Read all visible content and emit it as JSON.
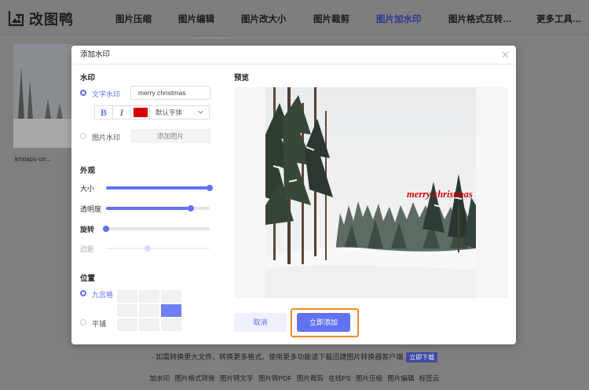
{
  "app": {
    "brand": "改图鸭"
  },
  "nav": {
    "items": [
      {
        "label": "图片压缩"
      },
      {
        "label": "图片编辑"
      },
      {
        "label": "图片改大小"
      },
      {
        "label": "图片裁剪"
      },
      {
        "label": "图片加水印",
        "active": true
      },
      {
        "label": "图片格式互转…"
      },
      {
        "label": "更多工具…"
      }
    ],
    "accent": "#2d3a92"
  },
  "background": {
    "thumb_label": "kristaps-un...",
    "notice": "· 如需转换更大文件、转换更多格式、使用更多功能请下载迅捷图片转换器客户端",
    "download_label": "立即下载",
    "footer_links": [
      "加水印",
      "图片格式转换",
      "图片转文字",
      "图片转PDF",
      "图片裁剪",
      "在线PS",
      "图片压缩",
      "图片编辑",
      "标签云"
    ]
  },
  "dialog": {
    "title": "添加水印",
    "watermark": {
      "section": "水印",
      "text_option": "文字水印",
      "text_value": "merry christmas",
      "bold": "B",
      "italic": "I",
      "color": "#d40000",
      "font": "默认字体",
      "image_option": "图片水印",
      "add_image": "添加图片"
    },
    "appearance": {
      "section": "外观",
      "size_label": "大小",
      "size_value": 1.0,
      "opacity_label": "透明度",
      "opacity_value": 0.82,
      "rotate_label": "旋转",
      "rotate_value": 0.0,
      "margin_label": "边距",
      "margin_value": 0.4
    },
    "position": {
      "section": "位置",
      "grid_option": "九宫格",
      "tile_option": "平铺",
      "selected_cell": 5
    },
    "preview": {
      "section": "预览",
      "watermark_text": "merry christmas"
    },
    "cancel_label": "取消",
    "confirm_label": "立即添加",
    "accent": "#6172f3",
    "highlight": "#f08a24"
  }
}
